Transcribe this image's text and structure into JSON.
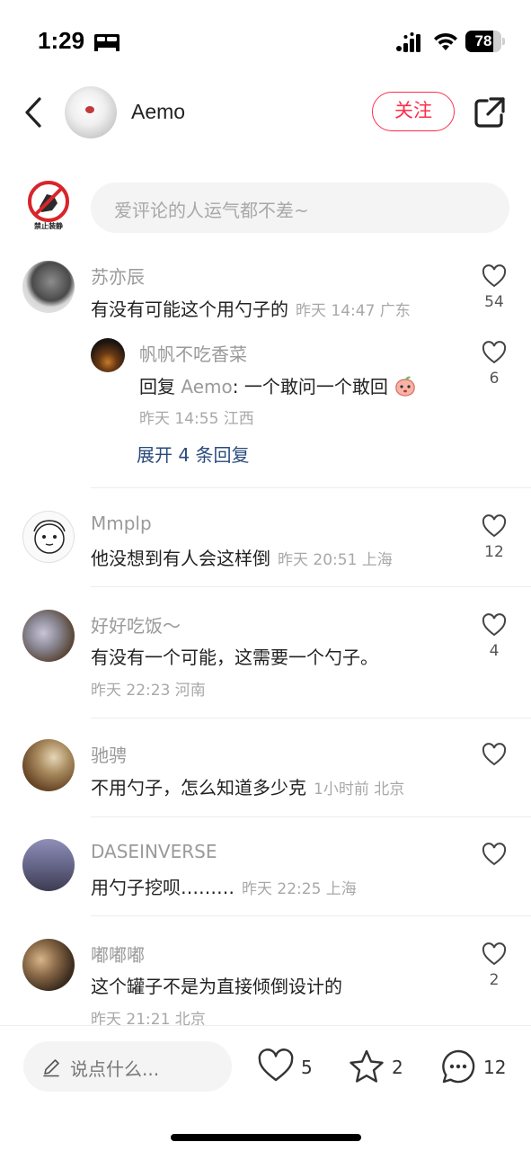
{
  "status_bar": {
    "time": "1:29",
    "battery": "78",
    "battery_level": 0.78
  },
  "header": {
    "author_name": "Aemo",
    "follow_label": "关注"
  },
  "comment_input": {
    "placeholder": "爱评论的人运气都不差~",
    "my_avatar_label": "禁止装静"
  },
  "comments": [
    {
      "name": "苏亦辰",
      "text": "有没有可能这个用勺子的",
      "meta": "昨天 14:47 广东",
      "likes": "54",
      "reply": {
        "name": "帆帆不吃香菜",
        "prefix": "回复",
        "target": "Aemo",
        "text": ": 一个敢问一个敢回",
        "meta": "昨天 14:55 江西",
        "likes": "6"
      },
      "expand_label": "展开 4 条回复"
    },
    {
      "name": "Mmplp",
      "text": "他没想到有人会这样倒",
      "meta": "昨天 20:51 上海",
      "likes": "12"
    },
    {
      "name": "好好吃饭～",
      "text": "有没有一个可能，这需要一个勺子。",
      "meta": "昨天 22:23 河南",
      "likes": "4"
    },
    {
      "name": "驰骋",
      "text": "不用勺子，怎么知道多少克",
      "meta": "1小时前 北京",
      "likes": ""
    },
    {
      "name": "DASEINVERSE",
      "text": "用勺子挖呗………",
      "meta": "昨天 22:25 上海",
      "likes": ""
    },
    {
      "name": "嘟嘟嘟",
      "text": "这个罐子不是为直接倾倒设计的",
      "meta": "昨天 21:21 北京",
      "likes": "2"
    }
  ],
  "bottom_bar": {
    "input_placeholder": "说点什么...",
    "like_count": "5",
    "star_count": "2",
    "comment_count": "12"
  },
  "colors": {
    "accent": "#ff2d4a",
    "link": "#2a4b7c",
    "muted_text": "#9a9a9a"
  }
}
